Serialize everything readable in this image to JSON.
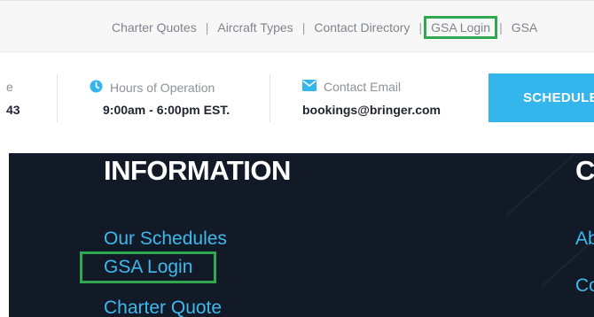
{
  "top_nav": {
    "items": [
      {
        "label": "Charter Quotes"
      },
      {
        "label": "Aircraft Types"
      },
      {
        "label": "Contact Directory"
      },
      {
        "label": "GSA Login"
      },
      {
        "label": "GSA"
      }
    ],
    "separator": "|"
  },
  "info_bar": {
    "phone": {
      "label_fragment": "e",
      "value_fragment": "43"
    },
    "hours": {
      "icon": "clock-icon",
      "label": "Hours of Operation",
      "value": "9:00am - 6:00pm EST."
    },
    "email": {
      "icon": "envelope-icon",
      "label": "Contact Email",
      "value": "bookings@bringer.com"
    },
    "schedule_button": "SCHEDULE"
  },
  "footer": {
    "information_heading": "INFORMATION",
    "next_heading_fragment": "C",
    "links": [
      {
        "label": "Our Schedules"
      },
      {
        "label": "GSA Login"
      },
      {
        "label": "Charter Quote"
      }
    ],
    "right_links": [
      {
        "label": "Ab"
      },
      {
        "label": "Co"
      }
    ]
  },
  "colors": {
    "accent_blue": "#34b6ec",
    "link_blue": "#3fb9ee",
    "highlight_green": "#2fa84f",
    "footer_bg": "#111a26"
  }
}
